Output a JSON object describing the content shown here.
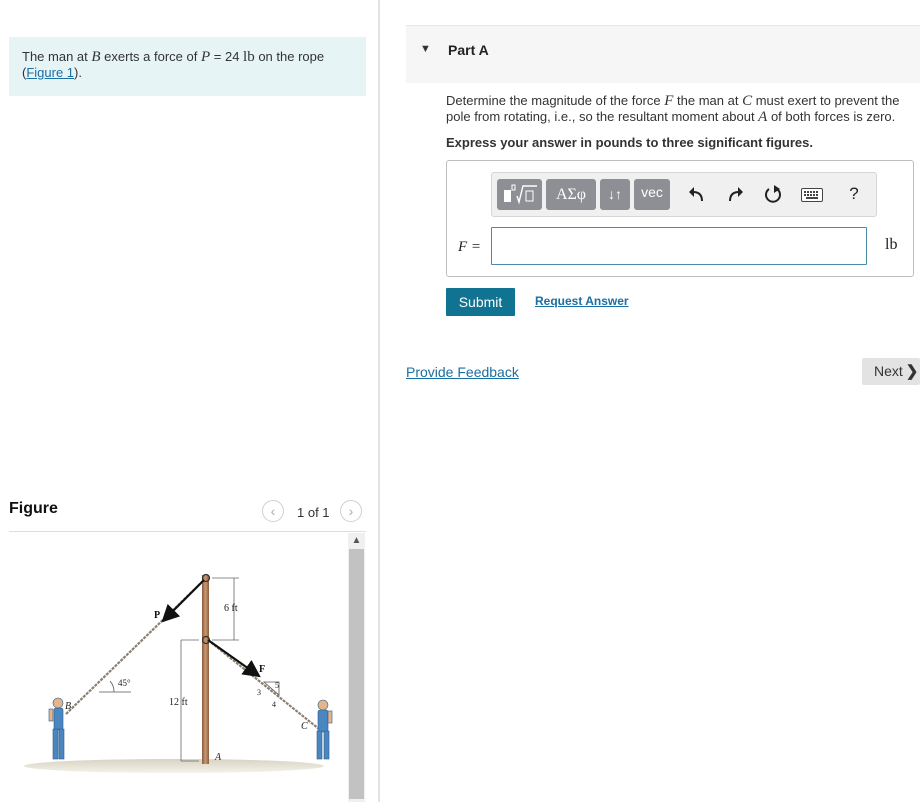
{
  "problem": {
    "text_before": "The man at ",
    "point_b": "B",
    "text_mid": " exerts a force of ",
    "force_var": "P",
    "force_value": " = 24 ",
    "force_unit": "lb",
    "text_after": " on the rope",
    "figure_link": "Figure 1",
    "open_paren": "(",
    "close_paren": ")."
  },
  "figure": {
    "title": "Figure",
    "counter": "1 of 1",
    "prev_icon": "chevron-left-icon",
    "next_icon": "chevron-right-icon",
    "labels": {
      "p": "P",
      "f": "F",
      "six_ft": "6 ft",
      "twelve_ft": "12 ft",
      "angle": "45°",
      "b": "B",
      "c": "C",
      "a": "A",
      "slope_3": "3",
      "slope_4": "4",
      "slope_5": "5"
    }
  },
  "part": {
    "title": "Part A",
    "caret_icon": "triangle-down-icon",
    "question": {
      "t1": "Determine the magnitude of the force ",
      "v1": "F",
      "t2": " the man at ",
      "v2": "C",
      "t3": " must exert to prevent the pole from rotating, i.e., so the resultant moment about ",
      "v3": "A",
      "t4": " of both forces is zero."
    },
    "instruction": "Express your answer in pounds to three significant figures."
  },
  "toolbar": {
    "templates_icon": "templates-icon",
    "greek_label": "ΑΣφ",
    "arrows_label": "↓↑",
    "vec_label": "vec",
    "undo_icon": "undo-icon",
    "redo_icon": "redo-icon",
    "reset_icon": "reset-icon",
    "keyboard_icon": "keyboard-icon",
    "help_label": "?"
  },
  "answer": {
    "variable_label": "F =",
    "value": "",
    "unit": "lb"
  },
  "actions": {
    "submit": "Submit",
    "request_answer": "Request Answer",
    "provide_feedback": "Provide Feedback",
    "next": "Next"
  },
  "colors": {
    "problem_bg": "#e6f4f6",
    "submit_bg": "#0f7391",
    "link": "#1a6fa3",
    "toolbar_dark": "#8d8f94"
  }
}
